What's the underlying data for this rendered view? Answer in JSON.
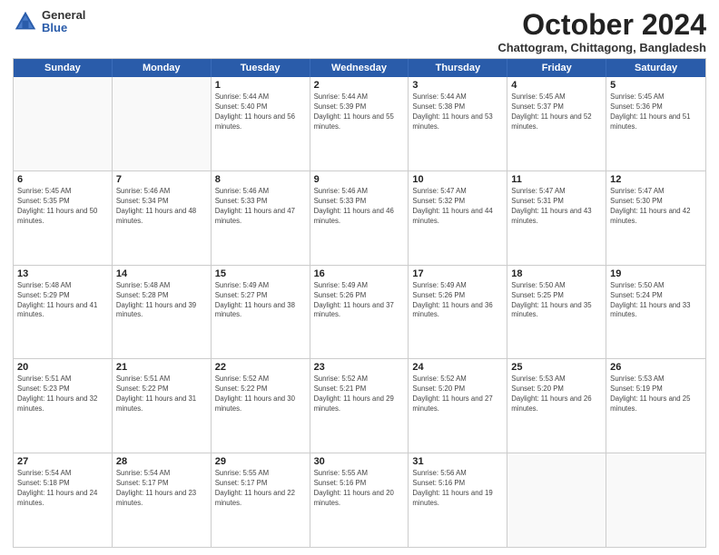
{
  "logo": {
    "general": "General",
    "blue": "Blue"
  },
  "title": "October 2024",
  "location": "Chattogram, Chittagong, Bangladesh",
  "header_days": [
    "Sunday",
    "Monday",
    "Tuesday",
    "Wednesday",
    "Thursday",
    "Friday",
    "Saturday"
  ],
  "weeks": [
    [
      {
        "day": "",
        "sunrise": "",
        "sunset": "",
        "daylight": ""
      },
      {
        "day": "",
        "sunrise": "",
        "sunset": "",
        "daylight": ""
      },
      {
        "day": "1",
        "sunrise": "Sunrise: 5:44 AM",
        "sunset": "Sunset: 5:40 PM",
        "daylight": "Daylight: 11 hours and 56 minutes."
      },
      {
        "day": "2",
        "sunrise": "Sunrise: 5:44 AM",
        "sunset": "Sunset: 5:39 PM",
        "daylight": "Daylight: 11 hours and 55 minutes."
      },
      {
        "day": "3",
        "sunrise": "Sunrise: 5:44 AM",
        "sunset": "Sunset: 5:38 PM",
        "daylight": "Daylight: 11 hours and 53 minutes."
      },
      {
        "day": "4",
        "sunrise": "Sunrise: 5:45 AM",
        "sunset": "Sunset: 5:37 PM",
        "daylight": "Daylight: 11 hours and 52 minutes."
      },
      {
        "day": "5",
        "sunrise": "Sunrise: 5:45 AM",
        "sunset": "Sunset: 5:36 PM",
        "daylight": "Daylight: 11 hours and 51 minutes."
      }
    ],
    [
      {
        "day": "6",
        "sunrise": "Sunrise: 5:45 AM",
        "sunset": "Sunset: 5:35 PM",
        "daylight": "Daylight: 11 hours and 50 minutes."
      },
      {
        "day": "7",
        "sunrise": "Sunrise: 5:46 AM",
        "sunset": "Sunset: 5:34 PM",
        "daylight": "Daylight: 11 hours and 48 minutes."
      },
      {
        "day": "8",
        "sunrise": "Sunrise: 5:46 AM",
        "sunset": "Sunset: 5:33 PM",
        "daylight": "Daylight: 11 hours and 47 minutes."
      },
      {
        "day": "9",
        "sunrise": "Sunrise: 5:46 AM",
        "sunset": "Sunset: 5:33 PM",
        "daylight": "Daylight: 11 hours and 46 minutes."
      },
      {
        "day": "10",
        "sunrise": "Sunrise: 5:47 AM",
        "sunset": "Sunset: 5:32 PM",
        "daylight": "Daylight: 11 hours and 44 minutes."
      },
      {
        "day": "11",
        "sunrise": "Sunrise: 5:47 AM",
        "sunset": "Sunset: 5:31 PM",
        "daylight": "Daylight: 11 hours and 43 minutes."
      },
      {
        "day": "12",
        "sunrise": "Sunrise: 5:47 AM",
        "sunset": "Sunset: 5:30 PM",
        "daylight": "Daylight: 11 hours and 42 minutes."
      }
    ],
    [
      {
        "day": "13",
        "sunrise": "Sunrise: 5:48 AM",
        "sunset": "Sunset: 5:29 PM",
        "daylight": "Daylight: 11 hours and 41 minutes."
      },
      {
        "day": "14",
        "sunrise": "Sunrise: 5:48 AM",
        "sunset": "Sunset: 5:28 PM",
        "daylight": "Daylight: 11 hours and 39 minutes."
      },
      {
        "day": "15",
        "sunrise": "Sunrise: 5:49 AM",
        "sunset": "Sunset: 5:27 PM",
        "daylight": "Daylight: 11 hours and 38 minutes."
      },
      {
        "day": "16",
        "sunrise": "Sunrise: 5:49 AM",
        "sunset": "Sunset: 5:26 PM",
        "daylight": "Daylight: 11 hours and 37 minutes."
      },
      {
        "day": "17",
        "sunrise": "Sunrise: 5:49 AM",
        "sunset": "Sunset: 5:26 PM",
        "daylight": "Daylight: 11 hours and 36 minutes."
      },
      {
        "day": "18",
        "sunrise": "Sunrise: 5:50 AM",
        "sunset": "Sunset: 5:25 PM",
        "daylight": "Daylight: 11 hours and 35 minutes."
      },
      {
        "day": "19",
        "sunrise": "Sunrise: 5:50 AM",
        "sunset": "Sunset: 5:24 PM",
        "daylight": "Daylight: 11 hours and 33 minutes."
      }
    ],
    [
      {
        "day": "20",
        "sunrise": "Sunrise: 5:51 AM",
        "sunset": "Sunset: 5:23 PM",
        "daylight": "Daylight: 11 hours and 32 minutes."
      },
      {
        "day": "21",
        "sunrise": "Sunrise: 5:51 AM",
        "sunset": "Sunset: 5:22 PM",
        "daylight": "Daylight: 11 hours and 31 minutes."
      },
      {
        "day": "22",
        "sunrise": "Sunrise: 5:52 AM",
        "sunset": "Sunset: 5:22 PM",
        "daylight": "Daylight: 11 hours and 30 minutes."
      },
      {
        "day": "23",
        "sunrise": "Sunrise: 5:52 AM",
        "sunset": "Sunset: 5:21 PM",
        "daylight": "Daylight: 11 hours and 29 minutes."
      },
      {
        "day": "24",
        "sunrise": "Sunrise: 5:52 AM",
        "sunset": "Sunset: 5:20 PM",
        "daylight": "Daylight: 11 hours and 27 minutes."
      },
      {
        "day": "25",
        "sunrise": "Sunrise: 5:53 AM",
        "sunset": "Sunset: 5:20 PM",
        "daylight": "Daylight: 11 hours and 26 minutes."
      },
      {
        "day": "26",
        "sunrise": "Sunrise: 5:53 AM",
        "sunset": "Sunset: 5:19 PM",
        "daylight": "Daylight: 11 hours and 25 minutes."
      }
    ],
    [
      {
        "day": "27",
        "sunrise": "Sunrise: 5:54 AM",
        "sunset": "Sunset: 5:18 PM",
        "daylight": "Daylight: 11 hours and 24 minutes."
      },
      {
        "day": "28",
        "sunrise": "Sunrise: 5:54 AM",
        "sunset": "Sunset: 5:17 PM",
        "daylight": "Daylight: 11 hours and 23 minutes."
      },
      {
        "day": "29",
        "sunrise": "Sunrise: 5:55 AM",
        "sunset": "Sunset: 5:17 PM",
        "daylight": "Daylight: 11 hours and 22 minutes."
      },
      {
        "day": "30",
        "sunrise": "Sunrise: 5:55 AM",
        "sunset": "Sunset: 5:16 PM",
        "daylight": "Daylight: 11 hours and 20 minutes."
      },
      {
        "day": "31",
        "sunrise": "Sunrise: 5:56 AM",
        "sunset": "Sunset: 5:16 PM",
        "daylight": "Daylight: 11 hours and 19 minutes."
      },
      {
        "day": "",
        "sunrise": "",
        "sunset": "",
        "daylight": ""
      },
      {
        "day": "",
        "sunrise": "",
        "sunset": "",
        "daylight": ""
      }
    ]
  ]
}
